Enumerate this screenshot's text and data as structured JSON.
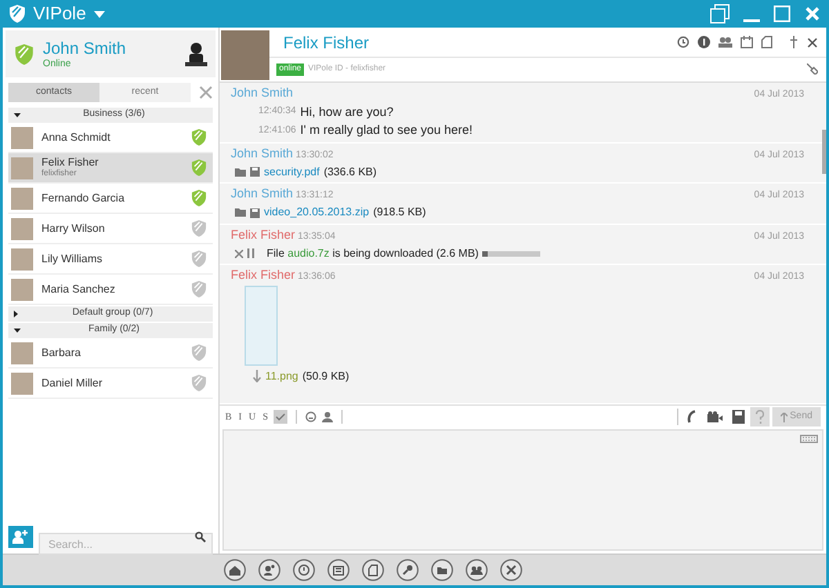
{
  "window": {
    "title": "VIPole"
  },
  "profile": {
    "name": "John Smith",
    "status": "Online"
  },
  "tabs": [
    {
      "label": "contacts",
      "selected": true
    },
    {
      "label": "recent",
      "selected": false
    }
  ],
  "groups": [
    {
      "label": "Business (3/6)",
      "expanded": true,
      "contacts": [
        {
          "name": "Anna Schmidt",
          "online": true,
          "selected": false
        },
        {
          "name": "Felix Fisher",
          "subtitle": "felixfisher",
          "online": true,
          "selected": true
        },
        {
          "name": "Fernando Garcia",
          "online": true,
          "selected": false
        },
        {
          "name": "Harry Wilson",
          "online": false,
          "selected": false
        },
        {
          "name": "Lily Williams",
          "online": false,
          "selected": false
        },
        {
          "name": "Maria Sanchez",
          "online": false,
          "selected": false
        }
      ]
    },
    {
      "label": "Default group (0/7)",
      "expanded": false
    },
    {
      "label": "Family (0/2)",
      "expanded": true,
      "contacts": [
        {
          "name": "Barbara",
          "online": false,
          "selected": false
        },
        {
          "name": "Daniel Miller",
          "online": false,
          "selected": false
        }
      ]
    }
  ],
  "search": {
    "placeholder": "Search..."
  },
  "chat": {
    "name": "Felix Fisher",
    "status": "online",
    "id_label": "VIPole ID - felixfisher",
    "messages": [
      {
        "sender": "John Smith",
        "color": "#5aa9d6",
        "date": "04 Jul 2013",
        "items": [
          {
            "kind": "text",
            "time": "12:40:34",
            "text": "Hi, how are you?"
          },
          {
            "kind": "text",
            "time": "12:41:06",
            "text": "I' m really glad to see you here!"
          }
        ]
      },
      {
        "sender": "John Smith",
        "color": "#5aa9d6",
        "time": "13:30:02",
        "date": "04 Jul 2013",
        "items": [
          {
            "kind": "file",
            "link": "security.pdf",
            "size": "(336.6 KB)"
          }
        ]
      },
      {
        "sender": "John Smith",
        "color": "#5aa9d6",
        "time": "13:31:12",
        "date": "04 Jul 2013",
        "items": [
          {
            "kind": "file",
            "link": "video_20.05.2013.zip",
            "size": "(918.5 KB)"
          }
        ]
      },
      {
        "sender": "Felix Fisher",
        "color": "#e06a6a",
        "time": "13:35:04",
        "date": "04 Jul 2013",
        "items": [
          {
            "kind": "download",
            "prefix": "File",
            "link": "audio.7z",
            "text": "is being downloaded (2.6 MB)",
            "level": 0.08
          }
        ]
      },
      {
        "sender": "Felix Fisher",
        "color": "#e06a6a",
        "time": "13:36:06",
        "date": "04 Jul 2013",
        "items": [
          {
            "kind": "image",
            "link": "11.png",
            "size": "(50.9 KB)"
          }
        ]
      }
    ]
  },
  "composer": {
    "format_buttons": [
      "B",
      "I",
      "U",
      "S"
    ],
    "send": "Send"
  }
}
